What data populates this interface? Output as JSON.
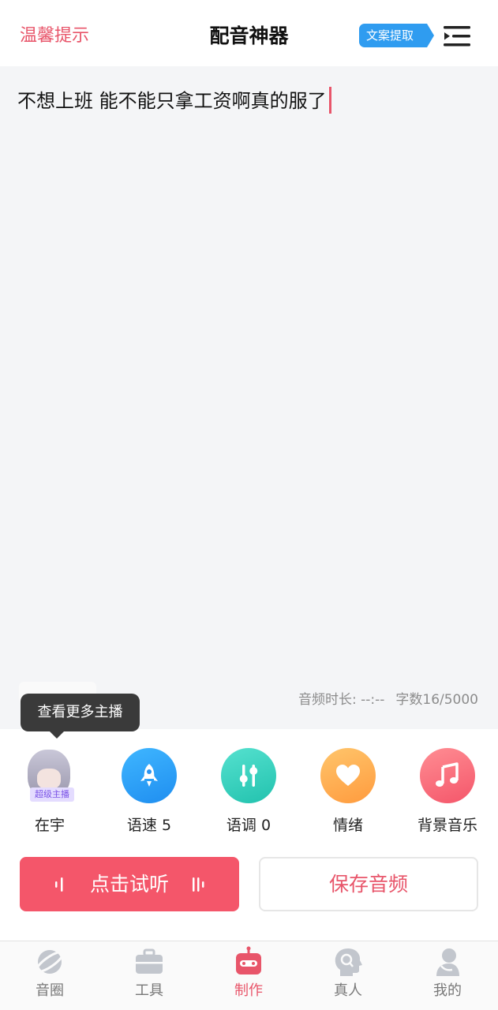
{
  "header": {
    "tip_link": "温馨提示",
    "title": "配音神器",
    "extract_badge": "文案提取",
    "menu_icon": "menu-icon"
  },
  "editor": {
    "text": "不想上班 能不能只拿工资啊真的服了",
    "duration_label": "音频时长: --:--",
    "char_count": "字数16/5000"
  },
  "tooltip": "查看更多主播",
  "controls": [
    {
      "label": "在宇",
      "icon": "avatar",
      "tag": "超级主播"
    },
    {
      "label": "语速 5",
      "icon": "rocket-icon",
      "color": "#2f9cf0"
    },
    {
      "label": "语调 0",
      "icon": "sliders-icon",
      "color": "#2fcdb9"
    },
    {
      "label": "情绪",
      "icon": "heart-icon",
      "color": "#ffad4f"
    },
    {
      "label": "背景音乐",
      "icon": "music-note-icon",
      "color": "#f4566a"
    }
  ],
  "actions": {
    "listen": "点击试听",
    "save": "保存音频"
  },
  "nav": [
    {
      "label": "音圈",
      "icon": "planet-icon",
      "active": false
    },
    {
      "label": "工具",
      "icon": "toolbox-icon",
      "active": false
    },
    {
      "label": "制作",
      "icon": "robot-icon",
      "active": true
    },
    {
      "label": "真人",
      "icon": "voice-head-icon",
      "active": false
    },
    {
      "label": "我的",
      "icon": "user-icon",
      "active": false
    }
  ],
  "colors": {
    "accent": "#e8556a",
    "badge_blue": "#2f9cf0",
    "editor_bg": "#f4f5f7"
  }
}
